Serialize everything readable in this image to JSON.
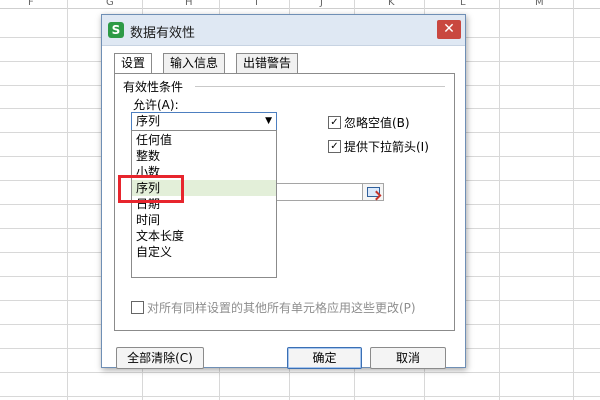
{
  "sheet": {
    "columns": [
      "F",
      "G",
      "H",
      "I",
      "J",
      "K",
      "L",
      "M"
    ]
  },
  "dialog": {
    "app_icon_letter": "S",
    "title": "数据有效性",
    "close_glyph": "✕",
    "tabs": [
      "设置",
      "输入信息",
      "出错警告"
    ],
    "section_title": "有效性条件",
    "allow_label": "允许(A):",
    "allow_selected": "序列",
    "allow_options": [
      "任何值",
      "整数",
      "小数",
      "序列",
      "日期",
      "时间",
      "文本长度",
      "自定义"
    ],
    "hovered_option": "序列",
    "ignore_blank_label": "忽略空值(B)",
    "ignore_blank_checked": true,
    "dropdown_arrow_label": "提供下拉箭头(I)",
    "dropdown_arrow_checked": true,
    "apply_all_label": "对所有同样设置的其他所有单元格应用这些更改(P)",
    "apply_all_checked": false,
    "buttons": {
      "clear_all": "全部清除(C)",
      "ok": "确定",
      "cancel": "取消"
    }
  },
  "colors": {
    "highlight": "#e7252d",
    "hover_row": "#e3efd9",
    "title_bg": "#dfe8f3"
  }
}
